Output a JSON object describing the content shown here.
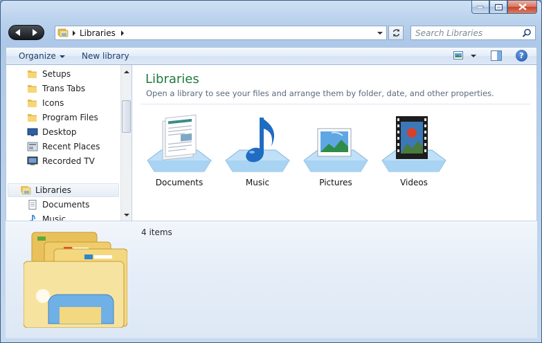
{
  "window": {
    "title": "Libraries"
  },
  "address_bar": {
    "path": "Libraries"
  },
  "search": {
    "placeholder": "Search Libraries"
  },
  "toolbar": {
    "organize_label": "Organize",
    "new_library_label": "New library",
    "help_label": "?"
  },
  "nav_pane": {
    "items": [
      {
        "label": "Setups",
        "icon": "folder-icon"
      },
      {
        "label": "Trans Tabs",
        "icon": "folder-icon"
      },
      {
        "label": "Icons",
        "icon": "folder-icon"
      },
      {
        "label": "Program Files",
        "icon": "folder-icon"
      },
      {
        "label": "Desktop",
        "icon": "desktop-icon"
      },
      {
        "label": "Recent Places",
        "icon": "recent-places-icon"
      },
      {
        "label": "Recorded TV",
        "icon": "tv-icon"
      },
      {
        "label": "Libraries",
        "icon": "libraries-icon"
      },
      {
        "label": "Documents",
        "icon": "documents-icon"
      },
      {
        "label": "Music",
        "icon": "music-icon"
      }
    ]
  },
  "content": {
    "heading": "Libraries",
    "subtitle": "Open a library to see your files and arrange them by folder, date, and other properties.",
    "libraries": [
      {
        "label": "Documents",
        "icon": "documents-library-icon"
      },
      {
        "label": "Music",
        "icon": "music-library-icon"
      },
      {
        "label": "Pictures",
        "icon": "pictures-library-icon"
      },
      {
        "label": "Videos",
        "icon": "videos-library-icon"
      }
    ]
  },
  "details": {
    "count": "4 items"
  },
  "colors": {
    "heading_green": "#1e7a3c",
    "toolbar_text": "#1e3e6a",
    "folder_yellow": "#f2d27a"
  }
}
